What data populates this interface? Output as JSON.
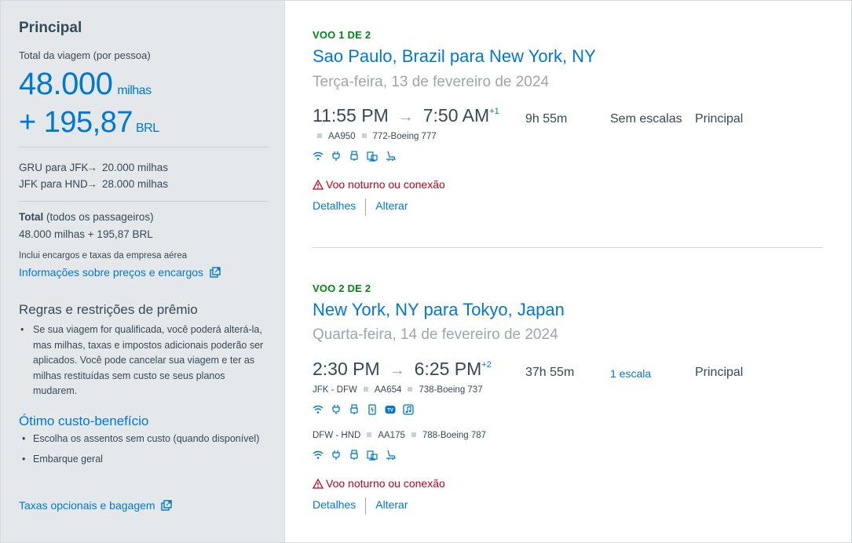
{
  "sidebar": {
    "title": "Principal",
    "trip_total_label": "Total da viagem (por pessoa)",
    "miles_amount": "48.000",
    "miles_unit": "milhas",
    "brl_prefix": "+",
    "brl_amount": "195,87",
    "brl_unit": "BRL",
    "segments": [
      {
        "route": "GRU para JFK",
        "miles": "20.000 milhas"
      },
      {
        "route": "JFK para HND",
        "miles": "28.000 milhas"
      }
    ],
    "total_bold": "Total",
    "total_rest": " (todos os passageiros)",
    "total_value": "48.000 milhas + 195,87 BRL",
    "includes_note": "Inclui encargos e taxas da empresa aérea",
    "pricing_link": "Informações sobre preços e encargos",
    "rules_title": "Regras e restrições de prêmio",
    "rules_text": "Se sua viagem for qualificada, você poderá alterá-la, mas milhas, taxas e impostos adicionais poderão ser aplicados. Você pode cancelar sua viagem e ter as milhas restituídas sem custo se seus planos mudarem.",
    "best_value_title": "Ótimo custo-benefício",
    "best_value_items": [
      "Escolha os assentos sem custo (quando disponível)",
      "Embarque geral"
    ],
    "optional_fees_link": "Taxas opcionais e bagagem"
  },
  "flights": [
    {
      "label": "VOO 1 DE 2",
      "route": "Sao Paulo, Brazil para New York, NY",
      "date": "Terça-feira, 13 de fevereiro de 2024",
      "depart": "11:55 PM",
      "arrive": "7:50 AM",
      "day_offset": "+1",
      "duration": "9h 55m",
      "stops": "Sem escalas",
      "cabin": "Principal",
      "legs": [
        {
          "route": "",
          "flight": "AA950",
          "aircraft": "772-Boeing 777",
          "amenities": [
            "wifi-icon",
            "power-icon",
            "usb-icon",
            "entertainment-icon",
            "lie-flat-seat-icon"
          ]
        }
      ],
      "warning": "Voo noturno ou conexão",
      "details": "Detalhes",
      "change": "Alterar"
    },
    {
      "label": "VOO 2 DE 2",
      "route": "New York, NY para Tokyo, Japan",
      "date": "Quarta-feira, 14 de fevereiro de 2024",
      "depart": "2:30 PM",
      "arrive": "6:25 PM",
      "day_offset": "+2",
      "duration": "37h 55m",
      "stops": "1 escala",
      "cabin": "Principal",
      "legs": [
        {
          "route": "JFK - DFW",
          "flight": "AA654",
          "aircraft": "738-Boeing 737",
          "amenities": [
            "wifi-icon",
            "power-icon",
            "usb-icon",
            "phone-icon",
            "tv-icon",
            "music-icon"
          ]
        },
        {
          "route": "DFW - HND",
          "flight": "AA175",
          "aircraft": "788-Boeing 787",
          "amenities": [
            "wifi-icon",
            "power-icon",
            "usb-icon",
            "entertainment-icon",
            "lie-flat-seat-icon"
          ]
        }
      ],
      "warning": "Voo noturno ou conexão",
      "details": "Detalhes",
      "change": "Alterar"
    }
  ],
  "colors": {
    "accent_blue": "#0078d2",
    "green_label": "#008712",
    "warning_red": "#c30019",
    "sidebar_bg": "#e4e8ea"
  }
}
